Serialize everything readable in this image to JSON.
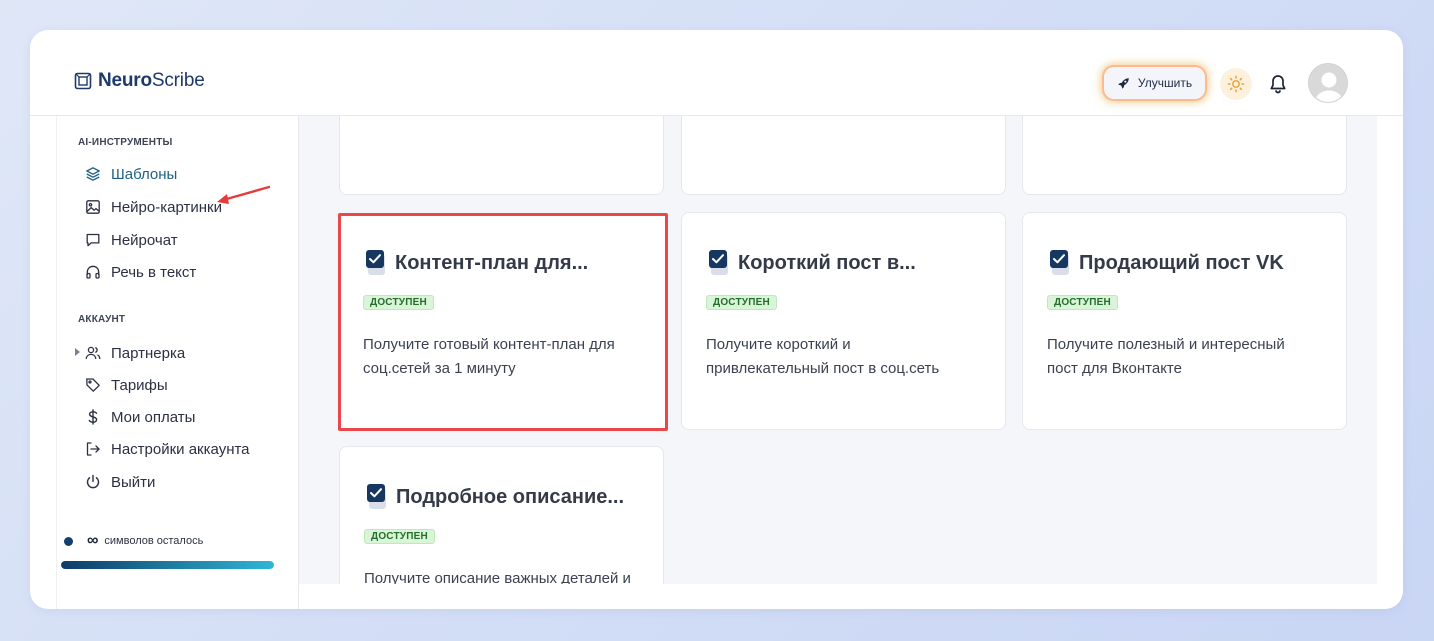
{
  "app": {
    "brand_bold": "Neuro",
    "brand_light": "Scribe"
  },
  "header": {
    "upgrade_label": "Улучшить",
    "icons": [
      "rocket-icon",
      "sun-icon",
      "bell-icon",
      "avatar"
    ]
  },
  "sidebar": {
    "section_tools": "AI-ИНСТРУМЕНТЫ",
    "tools": [
      {
        "label": "Шаблоны",
        "icon": "layers-icon",
        "active": true
      },
      {
        "label": "Нейро-картинки",
        "icon": "image-icon"
      },
      {
        "label": "Нейрочат",
        "icon": "chat-icon"
      },
      {
        "label": "Речь в текст",
        "icon": "headphones-icon"
      }
    ],
    "section_account": "АККАУНТ",
    "account": [
      {
        "label": "Партнерка",
        "icon": "users-icon"
      },
      {
        "label": "Тарифы",
        "icon": "tag-icon"
      },
      {
        "label": "Мои оплаты",
        "icon": "dollar-icon"
      },
      {
        "label": "Настройки аккаунта",
        "icon": "logout-arrow-icon"
      },
      {
        "label": "Выйти",
        "icon": "power-icon"
      }
    ],
    "symbols_infinity": "∞",
    "symbols_label": "символов осталось",
    "symbols_progress": 1.0
  },
  "cards": [
    {
      "title": "Контент-план для...",
      "badge": "ДОСТУПЕН",
      "desc": "Получите готовый контент-план для соц.сетей за 1 минуту"
    },
    {
      "title": "Короткий пост в...",
      "badge": "ДОСТУПЕН",
      "desc": "Получите короткий и привлекательный пост в соц.сеть"
    },
    {
      "title": "Продающий пост VK",
      "badge": "ДОСТУПЕН",
      "desc": "Получите полезный и интересный пост для Вконтакте"
    },
    {
      "title": "Подробное описание...",
      "badge": "ДОСТУПЕН",
      "desc": "Получите описание важных деталей и атмосферу изображения"
    }
  ],
  "colors": {
    "brand": "#1e3a6b",
    "highlight": "#e9474a",
    "badge_bg": "#d9f5d8",
    "badge_text": "#246e2c"
  }
}
